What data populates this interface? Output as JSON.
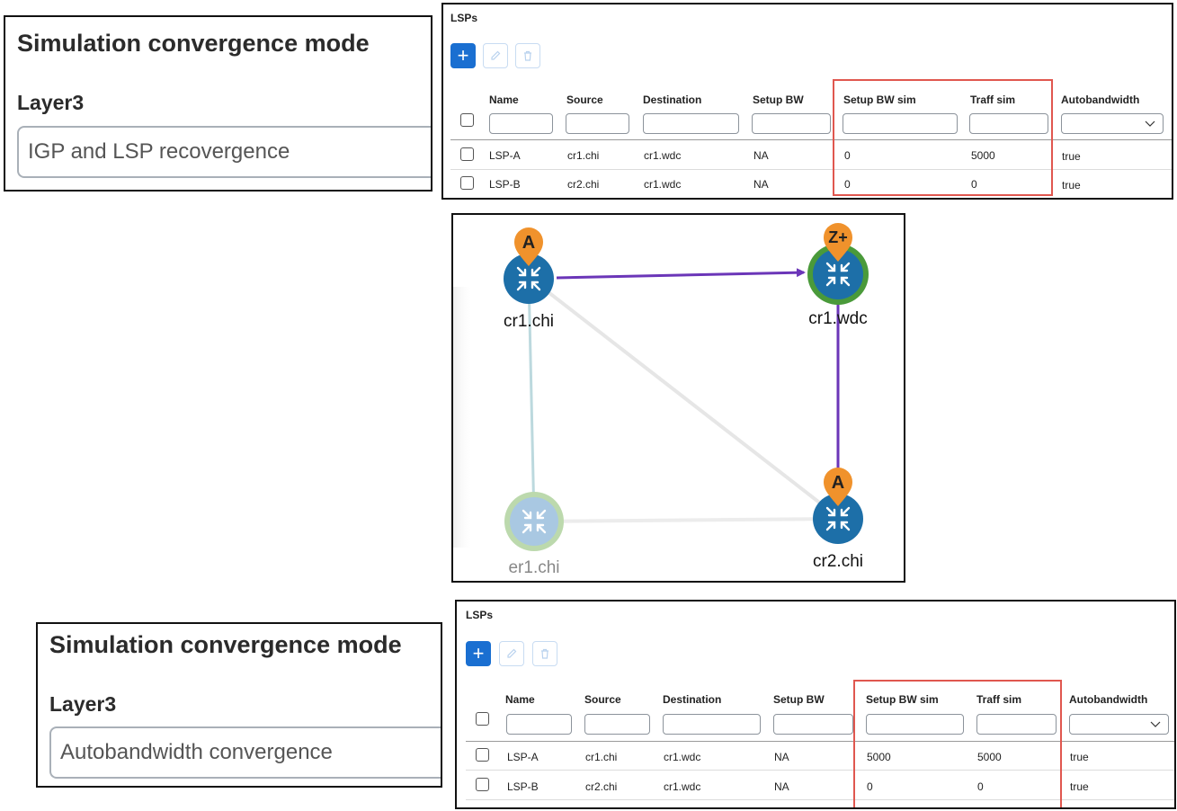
{
  "top": {
    "sim": {
      "title": "Simulation convergence mode",
      "layer": "Layer3",
      "mode": "IGP and LSP recovergence"
    },
    "lsps": {
      "heading": "LSPs",
      "add_label": "+",
      "columns": [
        "Name",
        "Source",
        "Destination",
        "Setup BW",
        "Setup BW sim",
        "Traff sim",
        "Autobandwidth"
      ],
      "rows": [
        {
          "name": "LSP-A",
          "source": "cr1.chi",
          "destination": "cr1.wdc",
          "setup_bw": "NA",
          "setup_bw_sim": "0",
          "traff_sim": "5000",
          "autobandwidth": "true"
        },
        {
          "name": "LSP-B",
          "source": "cr2.chi",
          "destination": "cr1.wdc",
          "setup_bw": "NA",
          "setup_bw_sim": "0",
          "traff_sim": "0",
          "autobandwidth": "true"
        }
      ]
    }
  },
  "topology": {
    "nodes": {
      "cr1_chi": {
        "label": "cr1.chi",
        "marker": "A"
      },
      "cr1_wdc": {
        "label": "cr1.wdc",
        "marker": "Z+"
      },
      "er1_chi": {
        "label": "er1.chi"
      },
      "cr2_chi": {
        "label": "cr2.chi",
        "marker": "A"
      }
    },
    "colors": {
      "node": "#1d6fa8",
      "node_faded": "#a9c8e2",
      "path": "#6b36b8",
      "pin": "#f0922c",
      "ring_green": "#4a9a3a",
      "ring_faded": "#bcd9ad"
    }
  },
  "bottom": {
    "sim": {
      "title": "Simulation convergence mode",
      "layer": "Layer3",
      "mode": "Autobandwidth convergence"
    },
    "lsps": {
      "heading": "LSPs",
      "add_label": "+",
      "columns": [
        "Name",
        "Source",
        "Destination",
        "Setup BW",
        "Setup BW sim",
        "Traff sim",
        "Autobandwidth"
      ],
      "rows": [
        {
          "name": "LSP-A",
          "source": "cr1.chi",
          "destination": "cr1.wdc",
          "setup_bw": "NA",
          "setup_bw_sim": "5000",
          "traff_sim": "5000",
          "autobandwidth": "true"
        },
        {
          "name": "LSP-B",
          "source": "cr2.chi",
          "destination": "cr1.wdc",
          "setup_bw": "NA",
          "setup_bw_sim": "0",
          "traff_sim": "0",
          "autobandwidth": "true"
        }
      ]
    }
  }
}
